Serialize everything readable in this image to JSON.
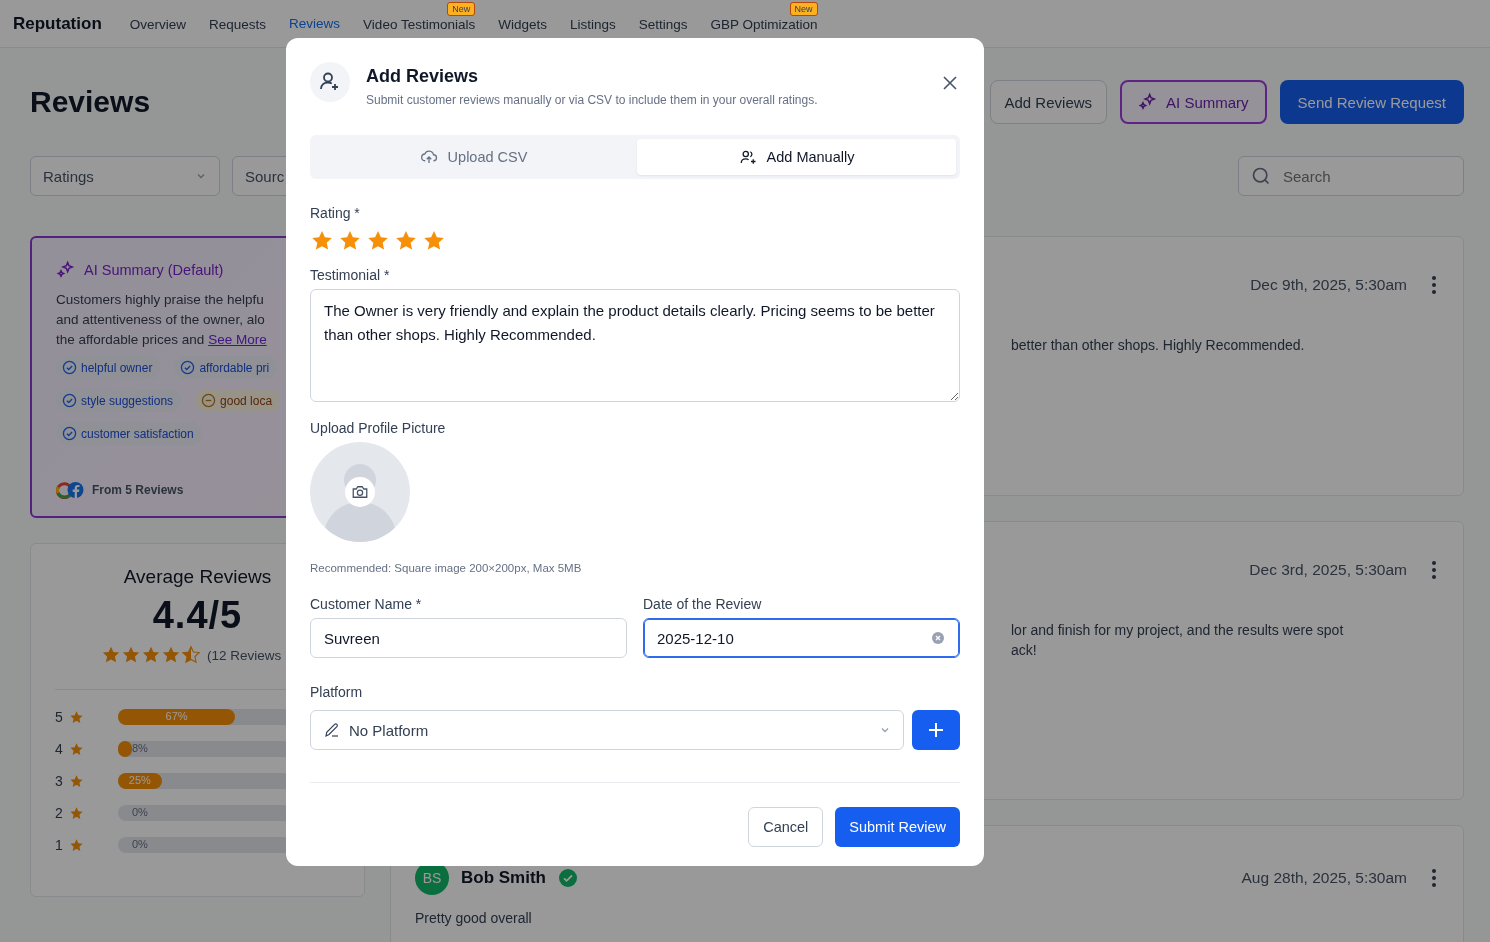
{
  "nav": {
    "brand": "Reputation",
    "tabs": [
      {
        "label": "Overview",
        "selected": false
      },
      {
        "label": "Requests",
        "selected": false
      },
      {
        "label": "Reviews",
        "selected": true
      },
      {
        "label": "Video Testimonials",
        "selected": false,
        "badge": "New"
      },
      {
        "label": "Widgets",
        "selected": false
      },
      {
        "label": "Listings",
        "selected": false
      },
      {
        "label": "Settings",
        "selected": false
      },
      {
        "label": "GBP Optimization",
        "selected": false,
        "badge": "New"
      }
    ]
  },
  "header": {
    "title": "Reviews",
    "buttons": [
      {
        "label": "Add Reviews",
        "kind": "outline"
      },
      {
        "label": "AI Summary",
        "kind": "ai"
      },
      {
        "label": "Send Review Request",
        "kind": "primary"
      }
    ]
  },
  "filters": [
    {
      "label": "Ratings"
    },
    {
      "label": "Sourc"
    }
  ],
  "search": {
    "placeholder": "Search"
  },
  "ai_summary": {
    "title": "AI Summary (Default)",
    "lines": [
      "Customers highly praise the helpfu",
      "and attentiveness of the owner, alo",
      "the affordable prices and"
    ],
    "link": "See More",
    "tags": [
      {
        "label": "helpful owner",
        "kind": "positive"
      },
      {
        "label": "affordable pri",
        "kind": "positive"
      },
      {
        "label": "style suggestions",
        "kind": "positive"
      },
      {
        "label": "good loca",
        "kind": "neutral"
      },
      {
        "label": "customer satisfaction",
        "kind": "positive"
      }
    ],
    "footer": "From 5 Reviews"
  },
  "average": {
    "title": "Average Reviews",
    "score": "4.4/5",
    "stars": 4.5,
    "count": "(12 Reviews",
    "bars": [
      {
        "label": "5",
        "level": 0.67,
        "value": "67%"
      },
      {
        "label": "4",
        "level": 0.08,
        "value": "8%"
      },
      {
        "label": "3",
        "level": 0.25,
        "value": "25%"
      },
      {
        "label": "2",
        "level": 0,
        "value": "0%"
      },
      {
        "label": "1",
        "level": 0,
        "value": "0%"
      }
    ]
  },
  "reviews": [
    {
      "date": "Dec 9th, 2025, 5:30am",
      "lines": [
        "better than other shops. Highly Recommended."
      ]
    },
    {
      "date": "Dec 3rd, 2025, 5:30am",
      "lines": [
        "lor and finish for my project, and the results were spot",
        "ack!"
      ]
    },
    {
      "date": "Aug 28th, 2025, 5:30am",
      "author": {
        "initials": "BS",
        "name": "Bob Smith",
        "verified": true
      },
      "lines": [
        "Pretty good overall"
      ]
    }
  ],
  "modal": {
    "title": "Add Reviews",
    "subtitle": "Submit customer reviews manually or via CSV to include them in your overall ratings.",
    "tabs": [
      {
        "label": "Upload CSV",
        "kind": "upload",
        "selected": false
      },
      {
        "label": "Add Manually",
        "kind": "manual",
        "selected": true
      }
    ],
    "rating": {
      "label": "Rating *",
      "stars": 5
    },
    "testimonial": {
      "label": "Testimonial *",
      "value": "The Owner is very friendly and explain the product details clearly. Pricing seems to be better than other shops. Highly Recommended."
    },
    "picture": {
      "label": "Upload Profile Picture",
      "hint": "Recommended: Square image 200×200px, Max 5MB"
    },
    "fields": [
      {
        "label": "Customer Name *",
        "value": "Suvreen",
        "focused": false,
        "clearable": false
      },
      {
        "label": "Date of the Review",
        "value": "2025-12-10",
        "focused": true,
        "clearable": true
      }
    ],
    "platform": {
      "label": "Platform",
      "value": "No Platform"
    },
    "buttons": [
      {
        "label": "Cancel",
        "kind": "secondary"
      },
      {
        "label": "Submit Review",
        "kind": "primary"
      }
    ]
  }
}
